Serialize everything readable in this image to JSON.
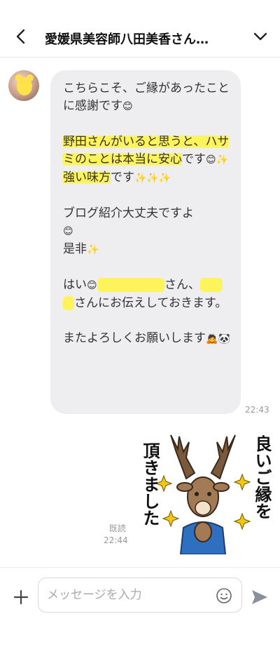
{
  "header": {
    "title": "愛媛県美容師八田美香さん…",
    "back_icon": "chevron-left-icon",
    "menu_icon": "chevron-down-icon"
  },
  "incoming_message": {
    "p1": "こちらこそ、ご縁があったことに感謝です",
    "p2_h1": "野田さんがいると思うと、ハサミのことは本当に安心",
    "p2_t1": "です",
    "p2_h2": "強い味方",
    "p2_t2": "です",
    "p3_a": "ブログ紹介大丈夫ですよ",
    "p3_b": "是非",
    "p4_a": "はい",
    "p4_b": "さん、",
    "p4_c": "さんにお伝えしておきます。",
    "p5": "またよろしくお願いします",
    "time": "22:43"
  },
  "outgoing_sticker": {
    "text_col1": "頂きました",
    "text_col2": "良いご縁を",
    "read_label": "既読",
    "time": "22:44"
  },
  "input_bar": {
    "placeholder": "メッセージを入力",
    "plus_icon": "plus-icon",
    "emoji_icon": "smiley-icon",
    "send_icon": "send-icon"
  },
  "colors": {
    "bubble_bg": "#eeeef0",
    "highlight": "#fdf35a",
    "header_text": "#111111",
    "meta_text": "#999999"
  }
}
